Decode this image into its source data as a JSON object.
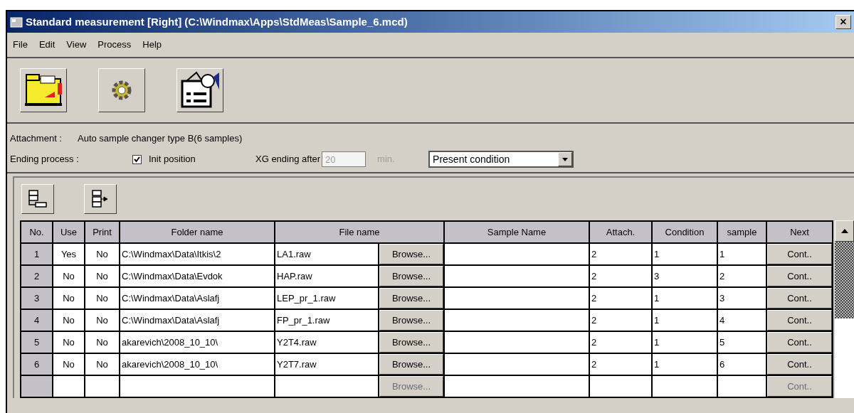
{
  "window": {
    "title": "Standard measurement [Right] (C:\\Windmax\\Apps\\StdMeas\\Sample_6.mcd)",
    "close": "×"
  },
  "menu": [
    "File",
    "Edit",
    "View",
    "Process",
    "Help"
  ],
  "attachment": {
    "label": "Attachment :",
    "value": "Auto sample changer type B(6 samples)"
  },
  "ending": {
    "label": "Ending process :",
    "init_position": {
      "label": "Init position",
      "checked": true
    },
    "xg_label": "XG ending after",
    "xg_value": "20",
    "xg_disabled": true,
    "unit": "min.",
    "condition": "Present condition"
  },
  "table": {
    "columns": [
      "No.",
      "Use",
      "Print",
      "Folder name",
      "File name",
      "Sample Name",
      "Attach.",
      "Condition",
      "sample",
      "Next"
    ],
    "rows": [
      {
        "no": "1",
        "use": "Yes",
        "print": "No",
        "folder": "C:\\Windmax\\Data\\Itkis\\2",
        "file": "LA1.raw",
        "attach": "2",
        "condition": "1",
        "sample": "1",
        "browse": {
          "label": "Browse...",
          "disabled": false
        },
        "next": {
          "label": "Cont..",
          "disabled": false
        }
      },
      {
        "no": "2",
        "use": "No",
        "print": "No",
        "folder": "C:\\Windmax\\Data\\Evdok",
        "file": "HAP.raw",
        "attach": "2",
        "condition": "3",
        "sample": "2",
        "browse": {
          "label": "Browse...",
          "disabled": false
        },
        "next": {
          "label": "Cont..",
          "disabled": false
        }
      },
      {
        "no": "3",
        "use": "No",
        "print": "No",
        "folder": "C:\\Windmax\\Data\\Aslafj",
        "file": "LEP_pr_1.raw",
        "attach": "2",
        "condition": "1",
        "sample": "3",
        "browse": {
          "label": "Browse...",
          "disabled": false
        },
        "next": {
          "label": "Cont..",
          "disabled": false
        }
      },
      {
        "no": "4",
        "use": "No",
        "print": "No",
        "folder": "C:\\Windmax\\Data\\Aslafj",
        "file": "FP_pr_1.raw",
        "attach": "2",
        "condition": "1",
        "sample": "4",
        "browse": {
          "label": "Browse...",
          "disabled": false
        },
        "next": {
          "label": "Cont..",
          "disabled": false
        }
      },
      {
        "no": "5",
        "use": "No",
        "print": "No",
        "folder": "akarevich\\2008_10_10\\",
        "file": "Y2T4.raw",
        "attach": "2",
        "condition": "1",
        "sample": "5",
        "browse": {
          "label": "Browse...",
          "disabled": false
        },
        "next": {
          "label": "Cont..",
          "disabled": false
        }
      },
      {
        "no": "6",
        "use": "No",
        "print": "No",
        "folder": "akarevich\\2008_10_10\\",
        "file": "Y2T7.raw",
        "attach": "2",
        "condition": "1",
        "sample": "6",
        "browse": {
          "label": "Browse...",
          "disabled": false
        },
        "next": {
          "label": "Cont..",
          "disabled": false
        }
      },
      {
        "browse": {
          "label": "Browse...",
          "disabled": true
        },
        "next": {
          "label": "Cont..",
          "disabled": true
        }
      }
    ]
  }
}
